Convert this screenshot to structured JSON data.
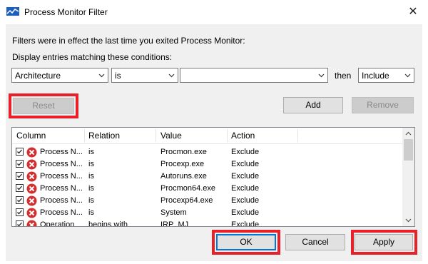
{
  "window": {
    "title": "Process Monitor Filter"
  },
  "intro_text": "Filters were in effect the last time you exited Process Monitor:",
  "conditions_label": "Display entries matching these conditions:",
  "filter_row": {
    "column": "Architecture",
    "relation": "is",
    "value": "",
    "then_label": "then",
    "action": "Include"
  },
  "buttons": {
    "reset": "Reset",
    "add": "Add",
    "remove": "Remove",
    "ok": "OK",
    "cancel": "Cancel",
    "apply": "Apply"
  },
  "table": {
    "headers": [
      "Column",
      "Relation",
      "Value",
      "Action"
    ],
    "rows": [
      {
        "column": "Process N...",
        "relation": "is",
        "value": "Procmon.exe",
        "action": "Exclude"
      },
      {
        "column": "Process N...",
        "relation": "is",
        "value": "Procexp.exe",
        "action": "Exclude"
      },
      {
        "column": "Process N...",
        "relation": "is",
        "value": "Autoruns.exe",
        "action": "Exclude"
      },
      {
        "column": "Process N...",
        "relation": "is",
        "value": "Procmon64.exe",
        "action": "Exclude"
      },
      {
        "column": "Process N...",
        "relation": "is",
        "value": "Procexp64.exe",
        "action": "Exclude"
      },
      {
        "column": "Process N...",
        "relation": "is",
        "value": "System",
        "action": "Exclude"
      },
      {
        "column": "Operation",
        "relation": "begins with",
        "value": "IRP_MJ_",
        "action": "Exclude"
      }
    ]
  },
  "icons": {
    "app": "process-monitor-icon",
    "close": "close-icon",
    "row_status": "exclude-x-icon",
    "dropdown": "chevron-down-icon"
  },
  "colors": {
    "highlight": "#e8202a",
    "exclude_icon": "#d32f2f",
    "default_button_border": "#0078d7"
  }
}
